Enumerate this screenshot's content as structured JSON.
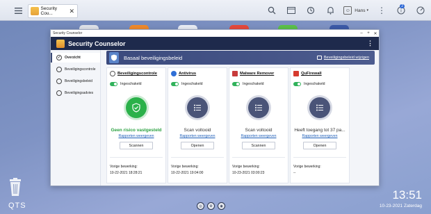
{
  "taskbar": {
    "tab_title": "Security Cou...",
    "user": "Hans",
    "notification_count": "2"
  },
  "window": {
    "titlebar": "Security Counselor",
    "app_title": "Security Counselor"
  },
  "sidebar": {
    "items": [
      {
        "label": "Overzicht"
      },
      {
        "label": "Beveiligingscontrole"
      },
      {
        "label": "Beveiligingsbeleid"
      },
      {
        "label": "Beveiligingsadvies"
      }
    ]
  },
  "banner": {
    "title": "Basaal beveiligingsbeleid",
    "edit_label": "Beveiligingsbeleid wijzigen"
  },
  "cards": [
    {
      "title": "Beveiligingscontrole",
      "toggle_label": "Ingeschakeld",
      "status": "Geen risico vastgesteld",
      "link": "Rapporten weergeven",
      "button": "Scannen",
      "last_label": "Vorige bewerking:",
      "last_value": "10-22-2021 18:28:21"
    },
    {
      "title": "Antivirus",
      "toggle_label": "Ingeschakeld",
      "status": "Scan voltooid",
      "link": "Rapporten weergeven",
      "button": "Openen",
      "last_label": "Vorige bewerking:",
      "last_value": "10-22-2021 19:04:00"
    },
    {
      "title": "Malware Remover",
      "toggle_label": "Ingeschakeld",
      "status": "Scan voltooid",
      "link": "Rapporten weergeven",
      "button": "Scannen",
      "last_label": "Vorige bewerking:",
      "last_value": "10-23-2021 03:00:23"
    },
    {
      "title": "QuFirewall",
      "toggle_label": "Ingeschakeld",
      "status": "Heeft toegang tot 37 pa...",
      "link": "Rapporten weergeven",
      "button": "Openen",
      "last_label": "Vorige bewerking:",
      "last_value": "--"
    }
  ],
  "desktop": {
    "logo": "QTS",
    "time": "13:51",
    "date": "10-23-2021 Zaterdag"
  }
}
